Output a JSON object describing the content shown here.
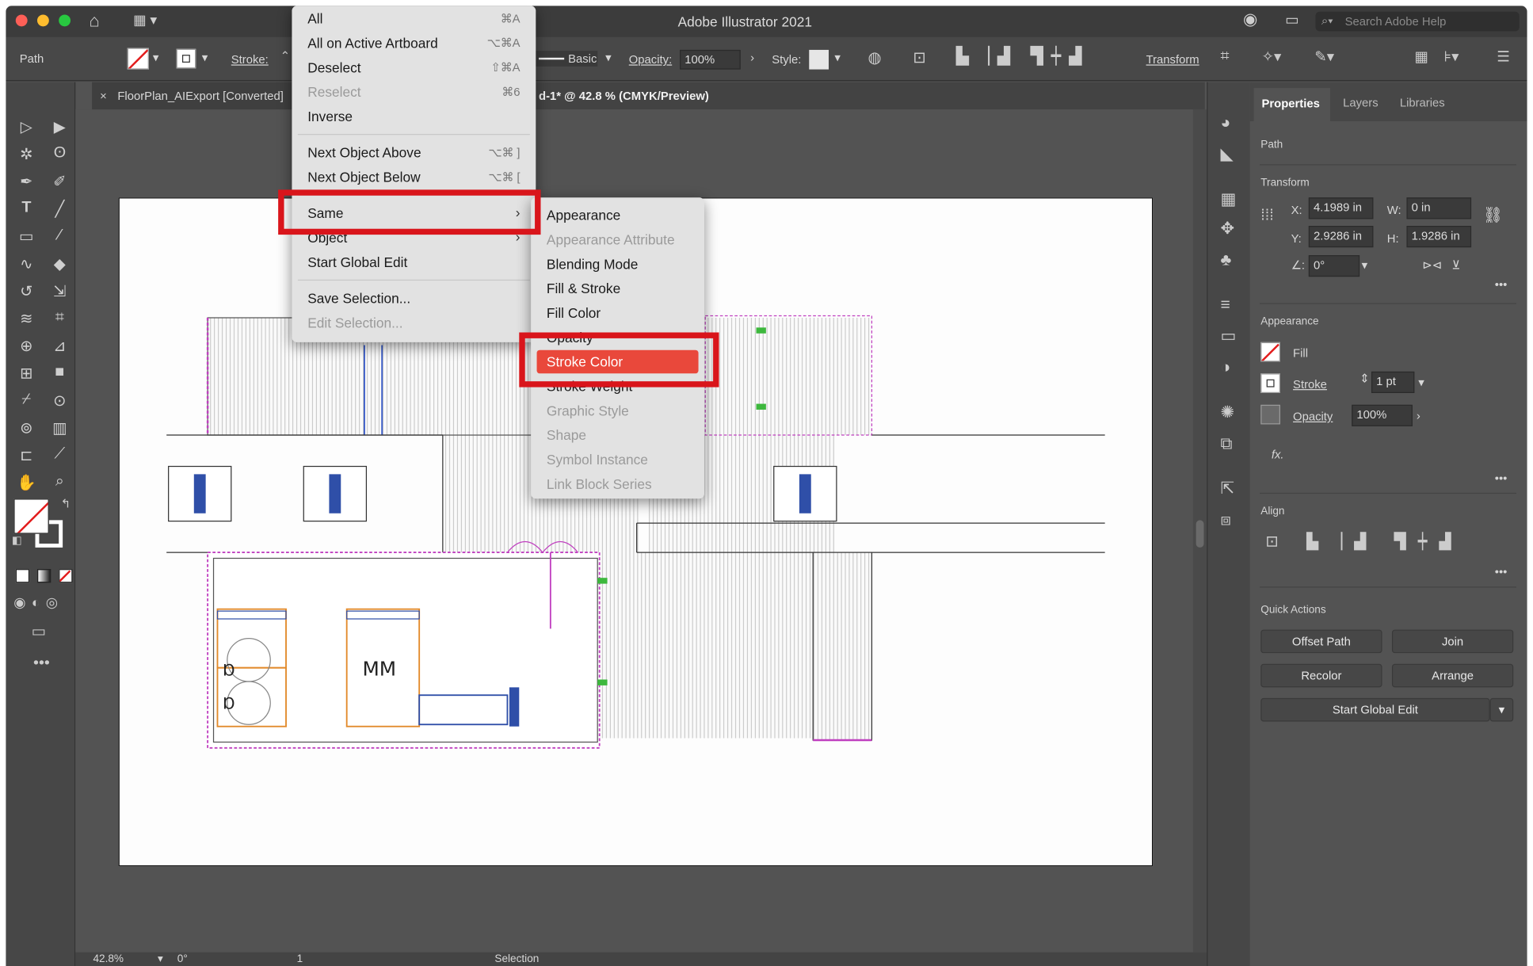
{
  "window": {
    "title": "Adobe Illustrator 2021",
    "search_placeholder": "Search Adobe Help"
  },
  "control_bar": {
    "selection_type": "Path",
    "stroke_label": "Stroke:",
    "brush_value": "Basic",
    "opacity_label": "Opacity:",
    "opacity_value": "100%",
    "style_label": "Style:",
    "transform_label": "Transform"
  },
  "document": {
    "tab1": "FloorPlan_AIExport [Converted]",
    "tab2_visible_suffix": "d-1* @ 42.8 % (CMYK/Preview)"
  },
  "select_menu": {
    "items": [
      {
        "label": "All",
        "shortcut": "⌘A",
        "disabled": false
      },
      {
        "label": "All on Active Artboard",
        "shortcut": "⌥⌘A",
        "disabled": false
      },
      {
        "label": "Deselect",
        "shortcut": "⇧⌘A",
        "disabled": false
      },
      {
        "label": "Reselect",
        "shortcut": "⌘6",
        "disabled": true
      },
      {
        "label": "Inverse",
        "shortcut": "",
        "disabled": false
      },
      {
        "label": "Next Object Above",
        "shortcut": "⌥⌘ ]",
        "disabled": false
      },
      {
        "label": "Next Object Below",
        "shortcut": "⌥⌘ [",
        "disabled": false
      },
      {
        "label": "Same",
        "shortcut": "",
        "disabled": false
      },
      {
        "label": "Object",
        "shortcut": "",
        "disabled": false
      },
      {
        "label": "Start Global Edit",
        "shortcut": "",
        "disabled": false
      },
      {
        "label": "Save Selection...",
        "shortcut": "",
        "disabled": false
      },
      {
        "label": "Edit Selection...",
        "shortcut": "",
        "disabled": true
      }
    ]
  },
  "same_submenu": {
    "items": [
      {
        "label": "Appearance",
        "disabled": false
      },
      {
        "label": "Appearance Attribute",
        "disabled": true
      },
      {
        "label": "Blending Mode",
        "disabled": false
      },
      {
        "label": "Fill & Stroke",
        "disabled": false
      },
      {
        "label": "Fill Color",
        "disabled": false
      },
      {
        "label": "Opacity",
        "disabled": false
      },
      {
        "label": "Stroke Color",
        "disabled": false
      },
      {
        "label": "Stroke Weight",
        "disabled": false
      },
      {
        "label": "Graphic Style",
        "disabled": true
      },
      {
        "label": "Shape",
        "disabled": true
      },
      {
        "label": "Symbol Instance",
        "disabled": true
      },
      {
        "label": "Link Block Series",
        "disabled": true
      }
    ],
    "highlighted": "Stroke Color"
  },
  "properties_panel": {
    "tabs": [
      "Properties",
      "Layers",
      "Libraries"
    ],
    "object_type": "Path",
    "transform": {
      "title": "Transform",
      "x_label": "X:",
      "x": "4.1989 in",
      "y_label": "Y:",
      "y": "2.9286 in",
      "w_label": "W:",
      "w": "0 in",
      "h_label": "H:",
      "h": "1.9286 in",
      "angle": "0°"
    },
    "appearance": {
      "title": "Appearance",
      "fill_label": "Fill",
      "stroke_label": "Stroke",
      "stroke_weight": "1 pt",
      "opacity_label": "Opacity",
      "opacity_value": "100%",
      "fx_label": "fx."
    },
    "align": {
      "title": "Align"
    },
    "quick_actions": {
      "title": "Quick Actions",
      "buttons": [
        "Offset Path",
        "Join",
        "Recolor",
        "Arrange"
      ],
      "global_edit": "Start Global Edit"
    }
  },
  "status_bar": {
    "zoom": "42.8%",
    "rotation": "0°",
    "artboard": "1",
    "tool": "Selection"
  },
  "colors": {
    "highlight_box": "#d9151b",
    "menu_highlight": "#e9483b",
    "ui_dark": "#535353"
  }
}
